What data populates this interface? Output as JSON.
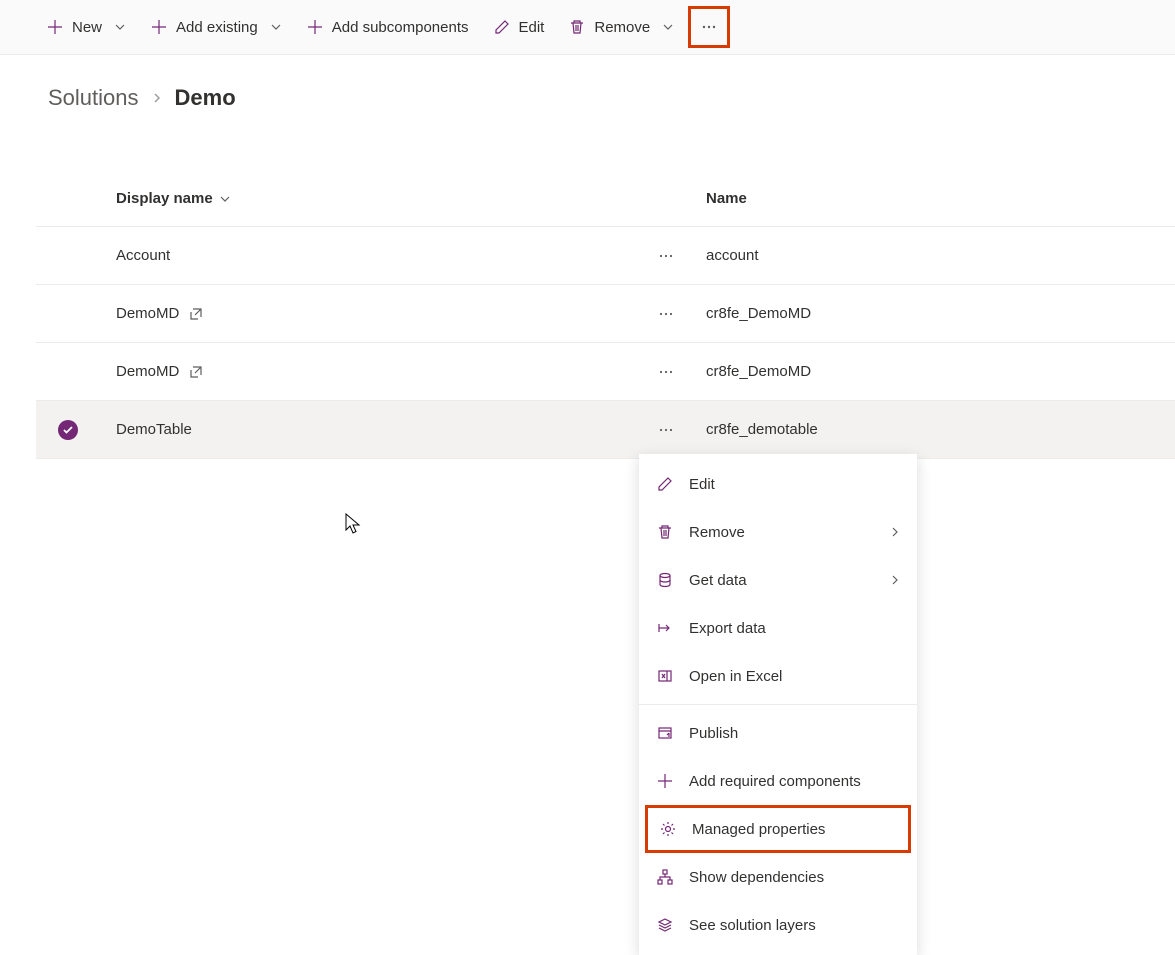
{
  "toolbar": {
    "new_label": "New",
    "add_existing_label": "Add existing",
    "add_subcomponents_label": "Add subcomponents",
    "edit_label": "Edit",
    "remove_label": "Remove"
  },
  "breadcrumb": {
    "parent": "Solutions",
    "current": "Demo"
  },
  "table": {
    "headers": {
      "display_name": "Display name",
      "name": "Name"
    },
    "rows": [
      {
        "display_name": "Account",
        "name": "account",
        "external": false,
        "selected": false
      },
      {
        "display_name": "DemoMD",
        "name": "cr8fe_DemoMD",
        "external": true,
        "selected": false
      },
      {
        "display_name": "DemoMD",
        "name": "cr8fe_DemoMD",
        "external": true,
        "selected": false
      },
      {
        "display_name": "DemoTable",
        "name": "cr8fe_demotable",
        "external": false,
        "selected": true
      }
    ]
  },
  "context_menu": {
    "edit": "Edit",
    "remove": "Remove",
    "get_data": "Get data",
    "export_data": "Export data",
    "open_in_excel": "Open in Excel",
    "publish": "Publish",
    "add_required": "Add required components",
    "managed_properties": "Managed properties",
    "show_dependencies": "Show dependencies",
    "see_solution_layers": "See solution layers"
  }
}
